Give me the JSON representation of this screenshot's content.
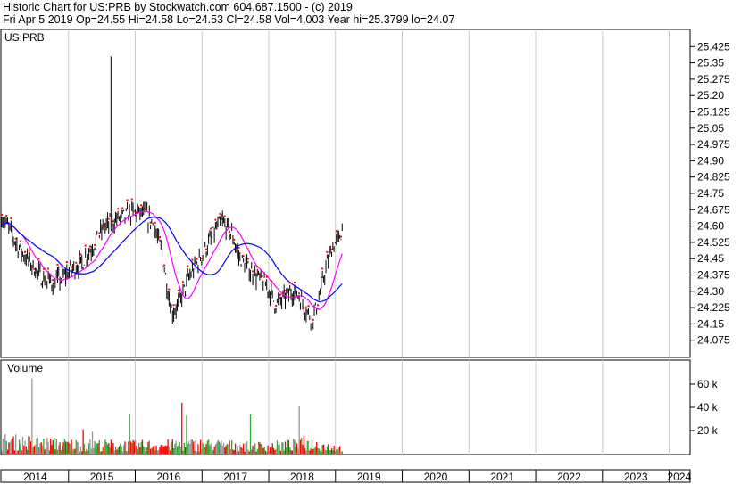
{
  "header": {
    "line1": "Historic Chart for US:PRB by Stockwatch.com 604.687.1500 - (c) 2019",
    "line2": "Fri Apr  5 2019  Op=24.55  Hi=24.58  Lo=24.53  Cl=24.58  Vol=4,003  Year hi=25.3799  lo=24.07"
  },
  "chart_data": {
    "type": "ohlc",
    "symbol_label": "US:PRB",
    "volume_label": "Volume",
    "price_axis": {
      "ylim": [
        24.0,
        25.5
      ],
      "ticks": [
        "25.425",
        "25.35",
        "25.275",
        "25.20",
        "25.125",
        "25.05",
        "24.975",
        "24.90",
        "24.825",
        "24.75",
        "24.675",
        "24.60",
        "24.525",
        "24.45",
        "24.375",
        "24.30",
        "24.225",
        "24.15",
        "24.075"
      ]
    },
    "volume_axis": {
      "ylim": [
        0,
        80000
      ],
      "ticks": [
        {
          "value": 60000,
          "label": "60 k"
        },
        {
          "value": 40000,
          "label": "40 k"
        },
        {
          "value": 20000,
          "label": "20 k"
        }
      ]
    },
    "x_axis": {
      "range": [
        2014.0,
        2024.3
      ],
      "years": [
        "2014",
        "2015",
        "2016",
        "2017",
        "2018",
        "2019",
        "2020",
        "2021",
        "2022",
        "2023",
        "2024"
      ]
    },
    "colors": {
      "bar": "#000000",
      "ma_fast": "#ff00ff",
      "ma_slow": "#0000ff",
      "vol_up": "#33aa33",
      "vol_down": "#ff0000",
      "vol_flat": "#999999",
      "dots": "#ff0000"
    },
    "price_path": [
      [
        2014.0,
        24.64
      ],
      [
        2014.12,
        24.58
      ],
      [
        2014.25,
        24.5
      ],
      [
        2014.45,
        24.42
      ],
      [
        2014.6,
        24.36
      ],
      [
        2014.75,
        24.34
      ],
      [
        2014.9,
        24.36
      ],
      [
        2015.05,
        24.4
      ],
      [
        2015.2,
        24.43
      ],
      [
        2015.35,
        24.5
      ],
      [
        2015.5,
        24.58
      ],
      [
        2015.65,
        24.62
      ],
      [
        2015.8,
        24.64
      ],
      [
        2015.95,
        24.66
      ],
      [
        2016.1,
        24.66
      ],
      [
        2016.25,
        24.62
      ],
      [
        2016.4,
        24.48
      ],
      [
        2016.5,
        24.28
      ],
      [
        2016.55,
        24.2
      ],
      [
        2016.65,
        24.24
      ],
      [
        2016.8,
        24.36
      ],
      [
        2016.95,
        24.44
      ],
      [
        2017.1,
        24.52
      ],
      [
        2017.2,
        24.58
      ],
      [
        2017.3,
        24.62
      ],
      [
        2017.45,
        24.56
      ],
      [
        2017.55,
        24.46
      ],
      [
        2017.7,
        24.4
      ],
      [
        2017.85,
        24.36
      ],
      [
        2018.0,
        24.31
      ],
      [
        2018.1,
        24.24
      ],
      [
        2018.2,
        24.26
      ],
      [
        2018.35,
        24.3
      ],
      [
        2018.45,
        24.28
      ],
      [
        2018.55,
        24.22
      ],
      [
        2018.65,
        24.17
      ],
      [
        2018.75,
        24.26
      ],
      [
        2018.85,
        24.4
      ],
      [
        2018.95,
        24.5
      ],
      [
        2019.05,
        24.54
      ],
      [
        2019.1,
        24.58
      ]
    ],
    "volume_levels": [
      [
        2014.0,
        12000
      ],
      [
        2015.0,
        9000
      ],
      [
        2016.0,
        8000
      ],
      [
        2017.0,
        9000
      ],
      [
        2018.0,
        7000
      ],
      [
        2018.6,
        10000
      ],
      [
        2019.1,
        5000
      ]
    ]
  }
}
